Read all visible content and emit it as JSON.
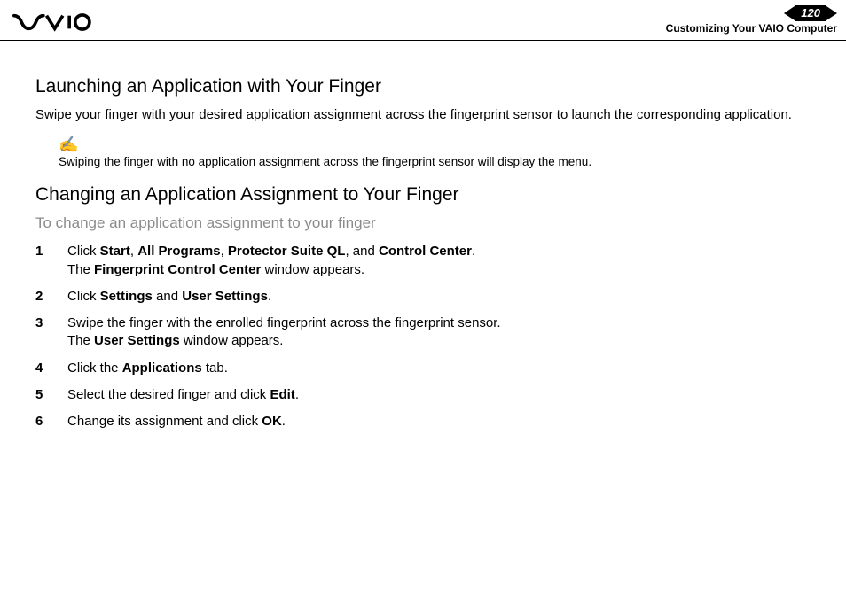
{
  "header": {
    "page_number": "120",
    "breadcrumb": "Customizing Your VAIO Computer"
  },
  "sections": {
    "launching": {
      "title": "Launching an Application with Your Finger",
      "body": "Swipe your finger with your desired application assignment across the fingerprint sensor to launch the corresponding application.",
      "note": "Swiping the finger with no application assignment across the fingerprint sensor will display the menu."
    },
    "changing": {
      "title": "Changing an Application Assignment to Your Finger",
      "subheading": "To change an application assignment to your finger",
      "steps": [
        {
          "num": "1",
          "parts": [
            "Click ",
            "Start",
            ", ",
            "All Programs",
            ", ",
            "Protector Suite QL",
            ", and ",
            "Control Center",
            "."
          ],
          "line2_parts": [
            "The ",
            "Fingerprint Control Center",
            " window appears."
          ]
        },
        {
          "num": "2",
          "parts": [
            "Click ",
            "Settings",
            " and ",
            "User Settings",
            "."
          ]
        },
        {
          "num": "3",
          "plain": "Swipe the finger with the enrolled fingerprint across the fingerprint sensor.",
          "line2_parts": [
            "The ",
            "User Settings",
            " window appears."
          ]
        },
        {
          "num": "4",
          "parts": [
            "Click the ",
            "Applications",
            " tab."
          ]
        },
        {
          "num": "5",
          "parts": [
            "Select the desired finger and click ",
            "Edit",
            "."
          ]
        },
        {
          "num": "6",
          "parts": [
            "Change its assignment and click ",
            "OK",
            "."
          ]
        }
      ]
    }
  }
}
